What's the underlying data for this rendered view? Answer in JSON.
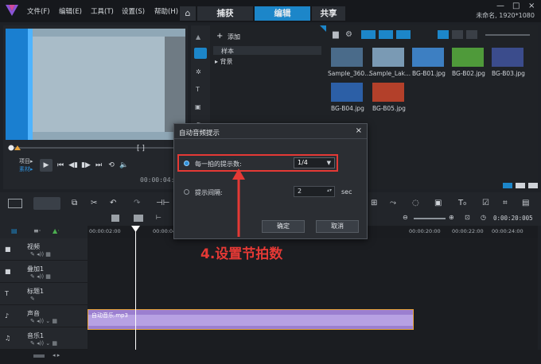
{
  "window": {
    "menu": [
      "文件(F)",
      "编辑(E)",
      "工具(T)",
      "设置(S)",
      "帮助(H)"
    ],
    "tabs": [
      "捕获",
      "编辑",
      "共享"
    ],
    "active_tab": "编辑",
    "project_info": "未命名, 1920*1080",
    "win_controls": [
      "—",
      "□",
      "×"
    ]
  },
  "preview": {
    "left_labels": [
      "项目▸",
      "素材▸"
    ],
    "timecode": "00:00:04:0",
    "bracket_label": "[ ]"
  },
  "library": {
    "add_label": "添加",
    "tree": [
      "样本",
      "▸ 背景"
    ],
    "thumbnails": [
      {
        "label": "Sample_360...",
        "color": "#4a6b8a"
      },
      {
        "label": "Sample_Lak...",
        "color": "#7a9ab4"
      },
      {
        "label": "BG-B01.jpg",
        "color": "#3d7fc2"
      },
      {
        "label": "BG-B02.jpg",
        "color": "#4f9a3a"
      },
      {
        "label": "BG-B03.jpg",
        "color": "#3b4c8c"
      },
      {
        "label": "BG-B04.jpg",
        "color": "#2c5fa6"
      },
      {
        "label": "BG-B05.jpg",
        "color": "#b3402a"
      }
    ]
  },
  "timeline": {
    "ruler_labels": [
      "00:00:02:00",
      "00:00:04:00",
      "00:00:20:00",
      "00:00:22:00",
      "00:00:24:00"
    ],
    "timecode": "0:00:20:005",
    "tracks": [
      {
        "name": "视频",
        "icon": "video-track-icon"
      },
      {
        "name": "叠加1",
        "icon": "overlay-track-icon"
      },
      {
        "name": "标题1",
        "icon": "title-track-icon"
      },
      {
        "name": "声音",
        "icon": "voice-track-icon"
      },
      {
        "name": "音乐1",
        "icon": "music-track-icon"
      }
    ],
    "clip_label": "自动音乐.mp3"
  },
  "dialog": {
    "title": "自动音频提示",
    "option1_label": "每一拍的提示数:",
    "option1_value": "1/4",
    "option2_label": "提示间隔:",
    "option2_value": "2",
    "option2_unit": "sec",
    "ok_label": "确定",
    "cancel_label": "取消"
  },
  "annotation": "4.设置节拍数",
  "colors": {
    "accent": "#1c86c9",
    "highlight": "#e53935",
    "clip": "#9b7fd0"
  }
}
